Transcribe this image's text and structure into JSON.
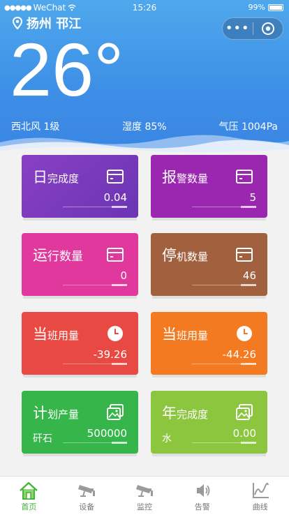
{
  "status_bar": {
    "carrier": "WeChat",
    "time": "15:26",
    "battery": "99%"
  },
  "location": "扬州 邗江",
  "weather": {
    "temperature": "26°",
    "wind": "西北风 1级",
    "humidity": "湿度 85%",
    "pressure": "气压 1004Pa"
  },
  "colors": {
    "header_top": "#4fa8ec",
    "header_bottom": "#3a86e3",
    "purple": "#7b3bbd",
    "magenta": "#9b27b0",
    "pink": "#e0389c",
    "brown": "#a1613e",
    "red": "#e84a43",
    "orange": "#f47a21",
    "green": "#36b54a",
    "lime": "#8cc63e",
    "tab_active": "#44b53a"
  },
  "cards": [
    {
      "title_big": "日",
      "title_rest": "完成度",
      "value": "0.04",
      "sub": "",
      "icon": "card-icon"
    },
    {
      "title_big": "报",
      "title_rest": "警数量",
      "value": "5",
      "sub": "",
      "icon": "card-icon"
    },
    {
      "title_big": "运",
      "title_rest": "行数量",
      "value": "0",
      "sub": "",
      "icon": "card-icon"
    },
    {
      "title_big": "停",
      "title_rest": "机数量",
      "value": "46",
      "sub": "",
      "icon": "card-icon"
    },
    {
      "title_big": "当",
      "title_rest": "班用量",
      "value": "-39.26",
      "sub": "",
      "icon": "clock-icon"
    },
    {
      "title_big": "当",
      "title_rest": "班用量",
      "value": "-44.26",
      "sub": "",
      "icon": "clock-icon"
    },
    {
      "title_big": "计",
      "title_rest": "划产量",
      "value": "500000",
      "sub": "矸石",
      "icon": "picture-icon"
    },
    {
      "title_big": "年",
      "title_rest": "完成度",
      "value": "0.00",
      "sub": "水",
      "icon": "picture-icon"
    }
  ],
  "tabs": [
    {
      "label": "首页",
      "icon": "home-icon",
      "active": true
    },
    {
      "label": "设备",
      "icon": "camera-icon"
    },
    {
      "label": "监控",
      "icon": "camera-icon"
    },
    {
      "label": "告警",
      "icon": "speaker-icon"
    },
    {
      "label": "曲线",
      "icon": "chart-icon"
    }
  ]
}
